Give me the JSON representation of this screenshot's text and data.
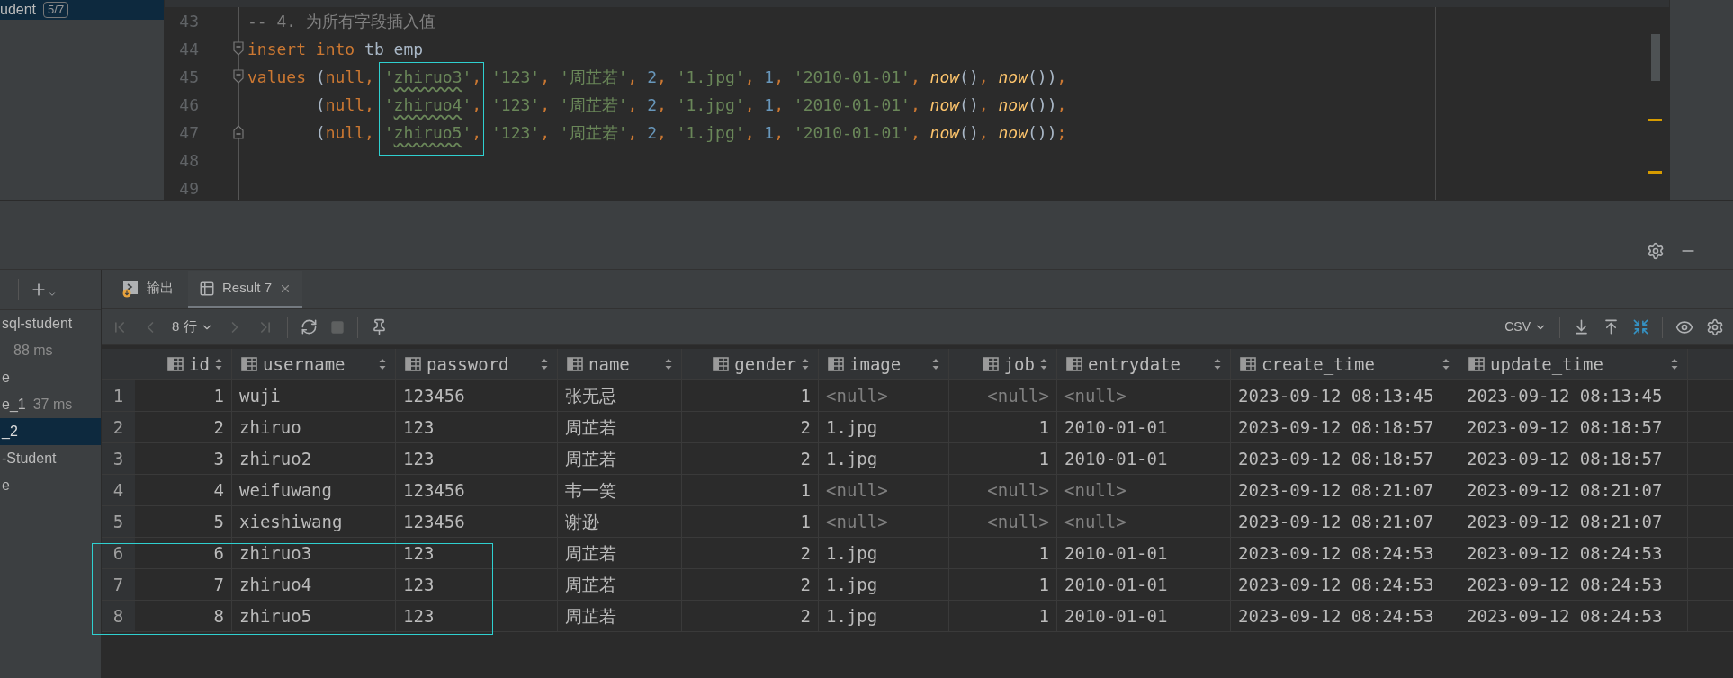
{
  "sidebar_top": {
    "items": [
      {
        "label": "udent",
        "badge": "5/7",
        "selected": true
      }
    ]
  },
  "editor": {
    "lines": [
      {
        "number": "43",
        "kind": "plain",
        "framed": false,
        "tokens": [
          {
            "kind": "comment",
            "text": "-- 4. 为所有字段插入值"
          }
        ]
      },
      {
        "number": "44",
        "kind": "fold_start",
        "framed": false,
        "tokens": [
          {
            "kind": "kw",
            "text": "insert into "
          },
          {
            "kind": "ident",
            "text": "tb_emp"
          }
        ]
      },
      {
        "number": "45",
        "kind": "fold_start",
        "framed": true,
        "tokens": [
          {
            "kind": "kw",
            "text": "values"
          },
          {
            "kind": "paren",
            "text": " ("
          },
          {
            "kind": "kw",
            "text": "null"
          },
          {
            "kind": "punct",
            "text": ", "
          },
          {
            "kind": "str",
            "text": "'"
          },
          {
            "kind": "str",
            "text": "zhiruo3",
            "typo": true
          },
          {
            "kind": "str",
            "text": "'"
          },
          {
            "kind": "punct",
            "text": ", "
          },
          {
            "kind": "str",
            "text": "'123'"
          },
          {
            "kind": "punct",
            "text": ", "
          },
          {
            "kind": "str",
            "text": "'周芷若'"
          },
          {
            "kind": "punct",
            "text": ", "
          },
          {
            "kind": "num",
            "text": "2"
          },
          {
            "kind": "punct",
            "text": ", "
          },
          {
            "kind": "str",
            "text": "'1.jpg'"
          },
          {
            "kind": "punct",
            "text": ", "
          },
          {
            "kind": "num",
            "text": "1"
          },
          {
            "kind": "punct",
            "text": ", "
          },
          {
            "kind": "str",
            "text": "'2010-01-01'"
          },
          {
            "kind": "punct",
            "text": ", "
          },
          {
            "kind": "fn",
            "text": "now"
          },
          {
            "kind": "paren",
            "text": "()"
          },
          {
            "kind": "punct",
            "text": ", "
          },
          {
            "kind": "fn",
            "text": "now"
          },
          {
            "kind": "paren",
            "text": "())"
          },
          {
            "kind": "punct",
            "text": ","
          }
        ]
      },
      {
        "number": "46",
        "kind": "plain",
        "framed": true,
        "tokens": [
          {
            "kind": "paren",
            "text": "       ("
          },
          {
            "kind": "kw",
            "text": "null"
          },
          {
            "kind": "punct",
            "text": ", "
          },
          {
            "kind": "str",
            "text": "'"
          },
          {
            "kind": "str",
            "text": "zhiruo4",
            "typo": true
          },
          {
            "kind": "str",
            "text": "'"
          },
          {
            "kind": "punct",
            "text": ", "
          },
          {
            "kind": "str",
            "text": "'123'"
          },
          {
            "kind": "punct",
            "text": ", "
          },
          {
            "kind": "str",
            "text": "'周芷若'"
          },
          {
            "kind": "punct",
            "text": ", "
          },
          {
            "kind": "num",
            "text": "2"
          },
          {
            "kind": "punct",
            "text": ", "
          },
          {
            "kind": "str",
            "text": "'1.jpg'"
          },
          {
            "kind": "punct",
            "text": ", "
          },
          {
            "kind": "num",
            "text": "1"
          },
          {
            "kind": "punct",
            "text": ", "
          },
          {
            "kind": "str",
            "text": "'2010-01-01'"
          },
          {
            "kind": "punct",
            "text": ", "
          },
          {
            "kind": "fn",
            "text": "now"
          },
          {
            "kind": "paren",
            "text": "()"
          },
          {
            "kind": "punct",
            "text": ", "
          },
          {
            "kind": "fn",
            "text": "now"
          },
          {
            "kind": "paren",
            "text": "())"
          },
          {
            "kind": "punct",
            "text": ","
          }
        ]
      },
      {
        "number": "47",
        "kind": "fold_end",
        "framed": true,
        "tokens": [
          {
            "kind": "paren",
            "text": "       ("
          },
          {
            "kind": "kw",
            "text": "null"
          },
          {
            "kind": "punct",
            "text": ", "
          },
          {
            "kind": "str",
            "text": "'"
          },
          {
            "kind": "str",
            "text": "zhiruo5",
            "typo": true
          },
          {
            "kind": "str",
            "text": "'"
          },
          {
            "kind": "punct",
            "text": ", "
          },
          {
            "kind": "str",
            "text": "'123'"
          },
          {
            "kind": "punct",
            "text": ", "
          },
          {
            "kind": "str",
            "text": "'周芷若'"
          },
          {
            "kind": "punct",
            "text": ", "
          },
          {
            "kind": "num",
            "text": "2"
          },
          {
            "kind": "punct",
            "text": ", "
          },
          {
            "kind": "str",
            "text": "'1.jpg'"
          },
          {
            "kind": "punct",
            "text": ", "
          },
          {
            "kind": "num",
            "text": "1"
          },
          {
            "kind": "punct",
            "text": ", "
          },
          {
            "kind": "str",
            "text": "'2010-01-01'"
          },
          {
            "kind": "punct",
            "text": ", "
          },
          {
            "kind": "fn",
            "text": "now"
          },
          {
            "kind": "paren",
            "text": "()"
          },
          {
            "kind": "punct",
            "text": ", "
          },
          {
            "kind": "fn",
            "text": "now"
          },
          {
            "kind": "paren",
            "text": "())"
          },
          {
            "kind": "punct",
            "text": ";"
          }
        ]
      },
      {
        "number": "48",
        "kind": "plain",
        "framed": false
      },
      {
        "number": "49",
        "kind": "plain",
        "framed": false
      }
    ]
  },
  "sidebar_bottom": {
    "items": [
      {
        "label": "sql-student",
        "selected": false
      },
      {
        "label": "88 ms",
        "selected": false,
        "kind": "time"
      },
      {
        "label": "e",
        "selected": false
      },
      {
        "label": "e_1",
        "selected": false,
        "time": "37 ms"
      },
      {
        "label": "_2",
        "selected": true
      },
      {
        "label": "-Student",
        "selected": false
      },
      {
        "label": "e",
        "selected": false
      }
    ]
  },
  "tabs": [
    {
      "label": "输出",
      "kind": "output",
      "selected": false,
      "closable": false
    },
    {
      "label": "Result 7",
      "kind": "result",
      "selected": true,
      "closable": true
    }
  ],
  "toolbar": {
    "page_size": "8 行",
    "export_format": "CSV"
  },
  "table": {
    "columns": [
      {
        "label": "id",
        "numeric": true
      },
      {
        "label": "username",
        "numeric": false
      },
      {
        "label": "password",
        "numeric": false
      },
      {
        "label": "name",
        "numeric": false
      },
      {
        "label": "gender",
        "numeric": true
      },
      {
        "label": "image",
        "numeric": false
      },
      {
        "label": "job",
        "numeric": true
      },
      {
        "label": "entrydate",
        "numeric": false
      },
      {
        "label": "create_time",
        "numeric": false
      },
      {
        "label": "update_time",
        "numeric": false
      }
    ],
    "rows": [
      {
        "number": "1",
        "framed": false,
        "cells": [
          "1",
          "wuji",
          "123456",
          "张无忌",
          "1",
          {
            "text": "<null>",
            "null": true
          },
          {
            "text": "<null>",
            "null": true
          },
          {
            "text": "<null>",
            "null": true
          },
          "2023-09-12 08:13:45",
          "2023-09-12 08:13:45"
        ]
      },
      {
        "number": "2",
        "framed": false,
        "cells": [
          "2",
          "zhiruo",
          "123",
          "周芷若",
          "2",
          "1.jpg",
          "1",
          "2010-01-01",
          "2023-09-12 08:18:57",
          "2023-09-12 08:18:57"
        ]
      },
      {
        "number": "3",
        "framed": false,
        "cells": [
          "3",
          "zhiruo2",
          "123",
          "周芷若",
          "2",
          "1.jpg",
          "1",
          "2010-01-01",
          "2023-09-12 08:18:57",
          "2023-09-12 08:18:57"
        ]
      },
      {
        "number": "4",
        "framed": false,
        "cells": [
          "4",
          "weifuwang",
          "123456",
          "韦一笑",
          "1",
          {
            "text": "<null>",
            "null": true
          },
          {
            "text": "<null>",
            "null": true
          },
          {
            "text": "<null>",
            "null": true
          },
          "2023-09-12 08:21:07",
          "2023-09-12 08:21:07"
        ]
      },
      {
        "number": "5",
        "framed": false,
        "cells": [
          "5",
          "xieshiwang",
          "123456",
          "谢逊",
          "1",
          {
            "text": "<null>",
            "null": true
          },
          {
            "text": "<null>",
            "null": true
          },
          {
            "text": "<null>",
            "null": true
          },
          "2023-09-12 08:21:07",
          "2023-09-12 08:21:07"
        ]
      },
      {
        "number": "6",
        "framed": true,
        "cells": [
          "6",
          "zhiruo3",
          "123",
          "周芷若",
          "2",
          "1.jpg",
          "1",
          "2010-01-01",
          "2023-09-12 08:24:53",
          "2023-09-12 08:24:53"
        ]
      },
      {
        "number": "7",
        "framed": true,
        "cells": [
          "7",
          "zhiruo4",
          "123",
          "周芷若",
          "2",
          "1.jpg",
          "1",
          "2010-01-01",
          "2023-09-12 08:24:53",
          "2023-09-12 08:24:53"
        ]
      },
      {
        "number": "8",
        "framed": true,
        "cells": [
          "8",
          "zhiruo5",
          "123",
          "周芷若",
          "2",
          "1.jpg",
          "1",
          "2010-01-01",
          "2023-09-12 08:24:53",
          "2023-09-12 08:24:53"
        ]
      }
    ]
  }
}
